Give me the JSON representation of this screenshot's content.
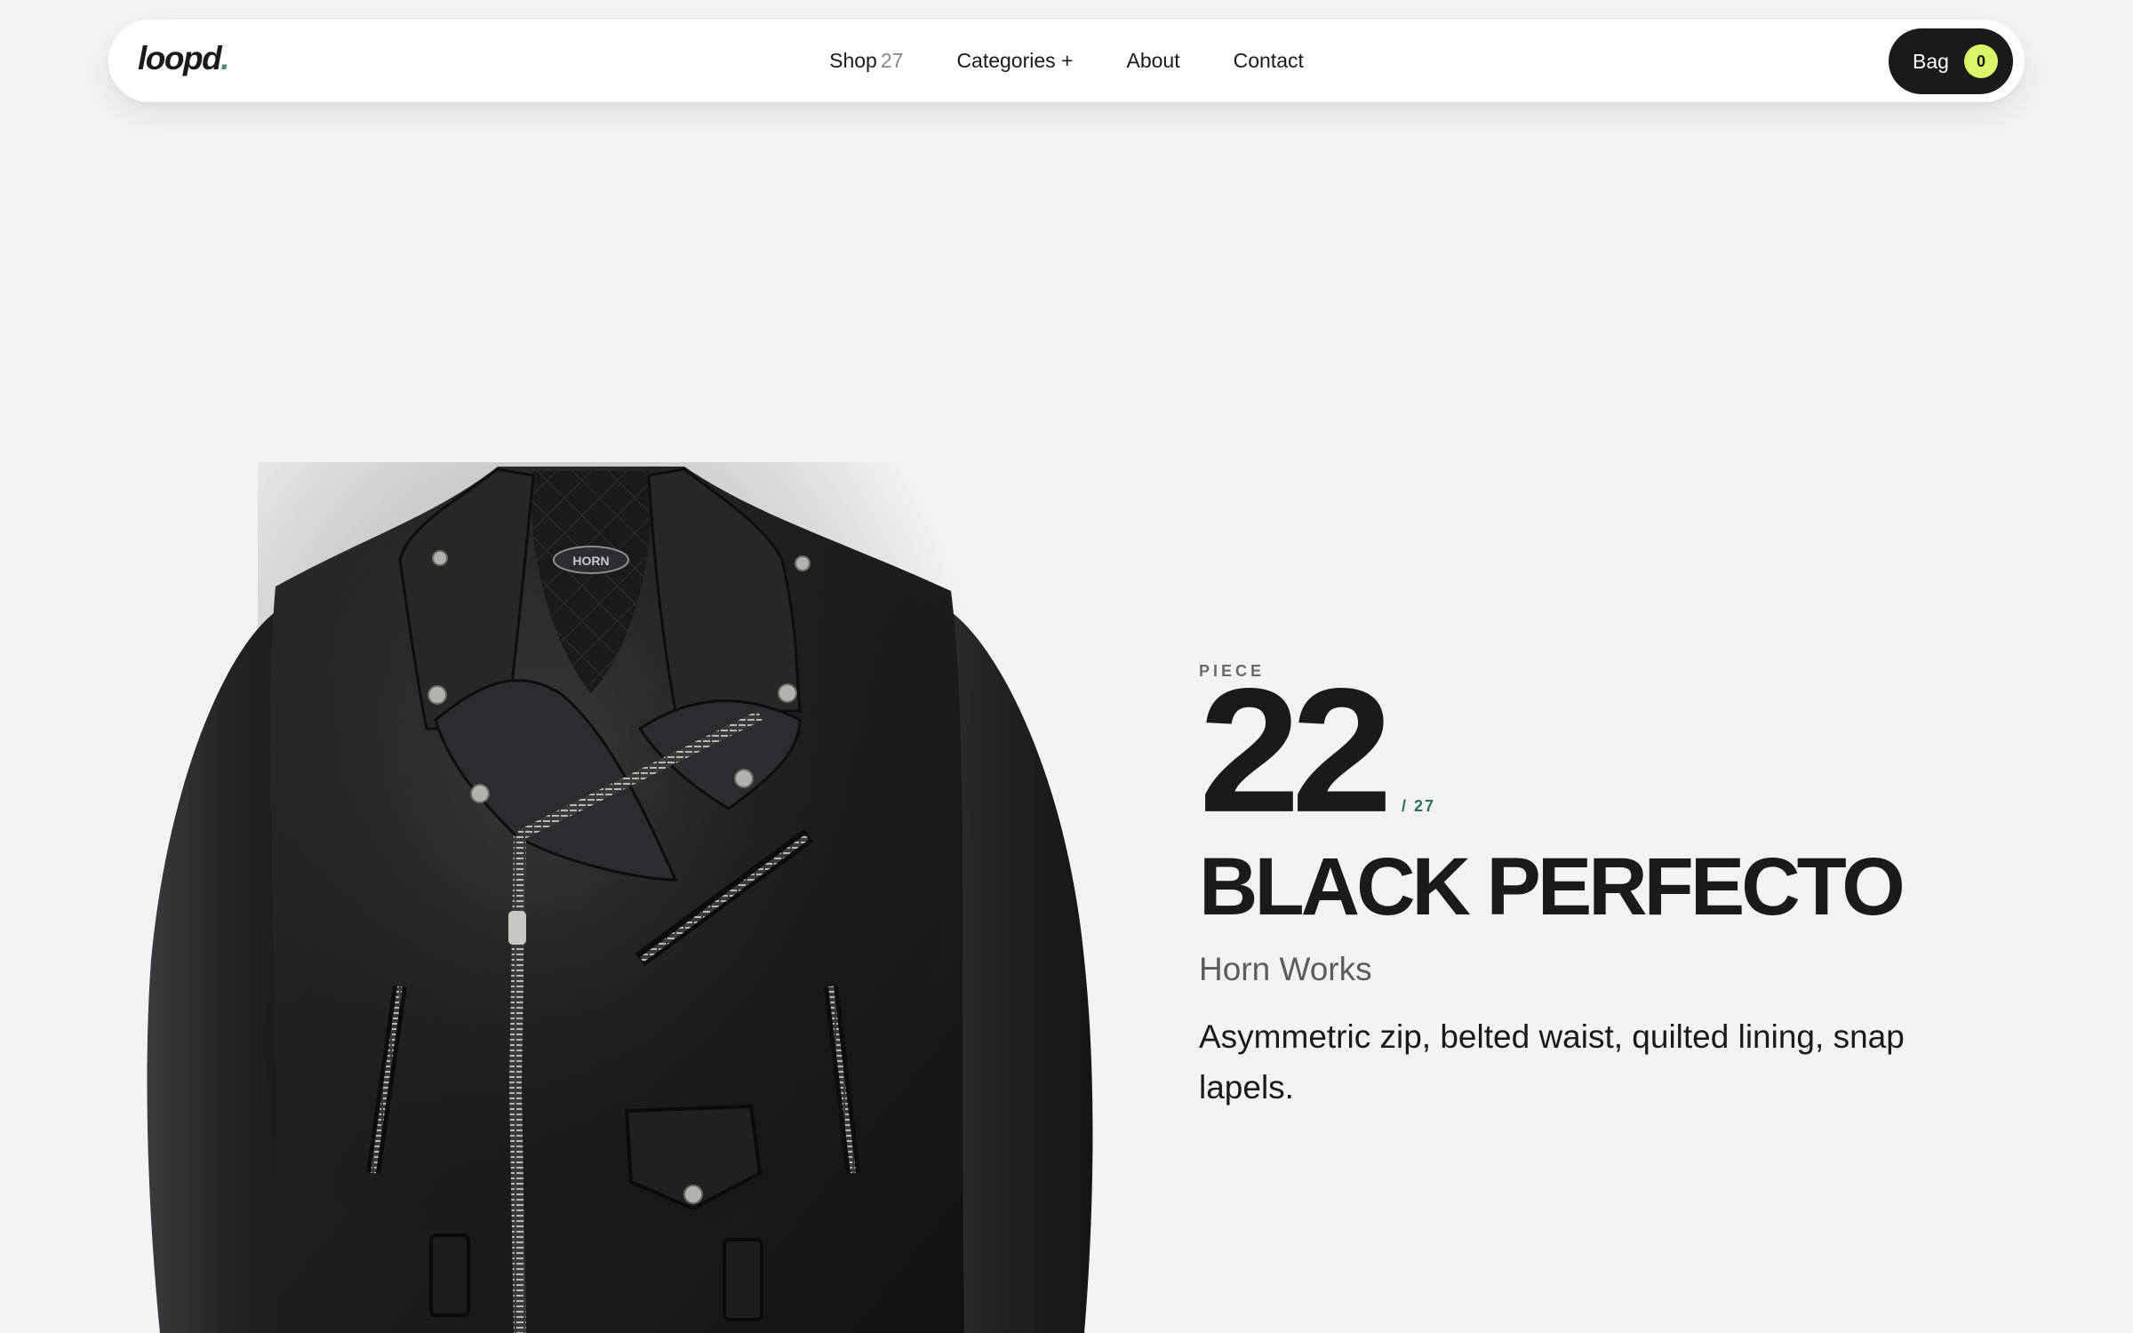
{
  "nav": {
    "logo": "loopd",
    "logo_dot": ".",
    "links": [
      {
        "label": "Shop",
        "count": "27"
      },
      {
        "label": "Categories +"
      },
      {
        "label": "About"
      },
      {
        "label": "Contact"
      }
    ],
    "bag": {
      "label": "Bag",
      "count": "0"
    }
  },
  "product": {
    "piece_label": "PIECE",
    "piece_number": "22",
    "piece_total": "/ 27",
    "title": "BLACK PERFECTO",
    "brand": "Horn Works",
    "description": "Asymmetric zip, belted waist, quilted lining, snap lapels.",
    "image_label": "HORN WORKS",
    "image_subject": "black leather motorcycle jacket"
  },
  "colors": {
    "background": "#f4f3f1",
    "accent_lime": "#d9f768",
    "accent_teal": "#2f6f61",
    "ink": "#1b1a19"
  }
}
